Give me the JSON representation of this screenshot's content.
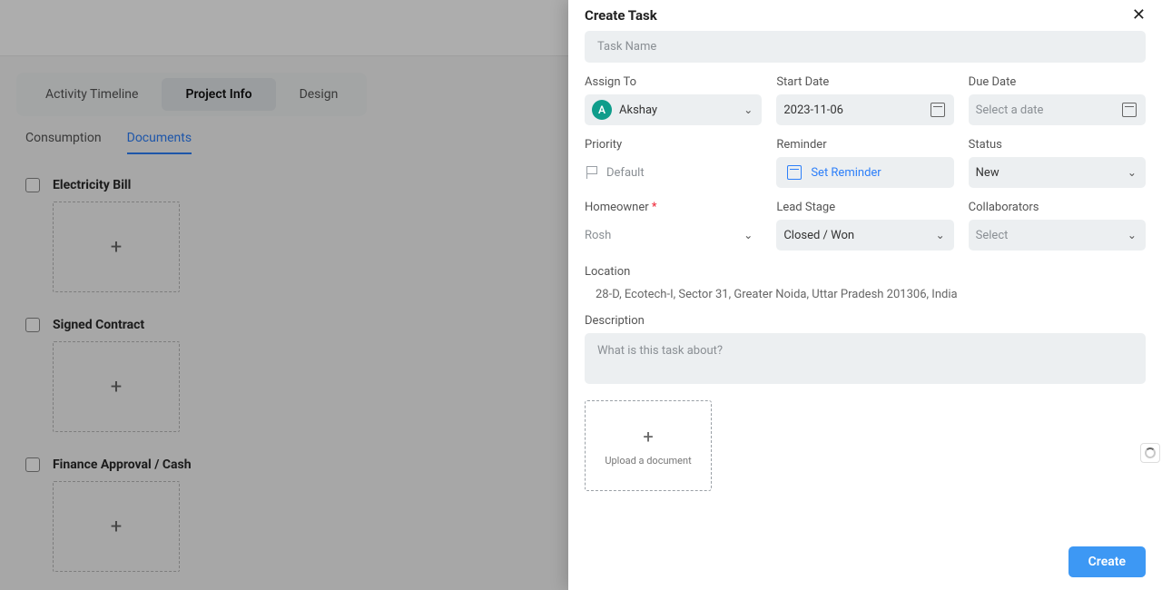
{
  "main_tabs": {
    "timeline": "Activity Timeline",
    "project_info": "Project Info",
    "design": "Design"
  },
  "sub_tabs": {
    "consumption": "Consumption",
    "documents": "Documents"
  },
  "doc_sections": {
    "electricity": "Electricity Bill",
    "contract": "Signed Contract",
    "finance": "Finance Approval / Cash"
  },
  "drawer": {
    "title": "Create Task",
    "task_name_placeholder": "Task Name",
    "labels": {
      "assign_to": "Assign To",
      "start_date": "Start Date",
      "due_date": "Due Date",
      "priority": "Priority",
      "reminder": "Reminder",
      "status": "Status",
      "homeowner": "Homeowner",
      "lead_stage": "Lead Stage",
      "collaborators": "Collaborators",
      "location": "Location",
      "description": "Description"
    },
    "values": {
      "assign_initial": "A",
      "assign_to": "Akshay",
      "start_date": "2023-11-06",
      "due_date_placeholder": "Select a date",
      "priority": "Default",
      "reminder": "Set Reminder",
      "status": "New",
      "homeowner": "Rosh",
      "lead_stage": "Closed / Won",
      "collaborators": "Select",
      "location": "28-D, Ecotech-I, Sector 31, Greater Noida, Uttar Pradesh 201306, India",
      "description_placeholder": "What is this task about?",
      "upload_label": "Upload a document"
    },
    "create_btn": "Create"
  }
}
